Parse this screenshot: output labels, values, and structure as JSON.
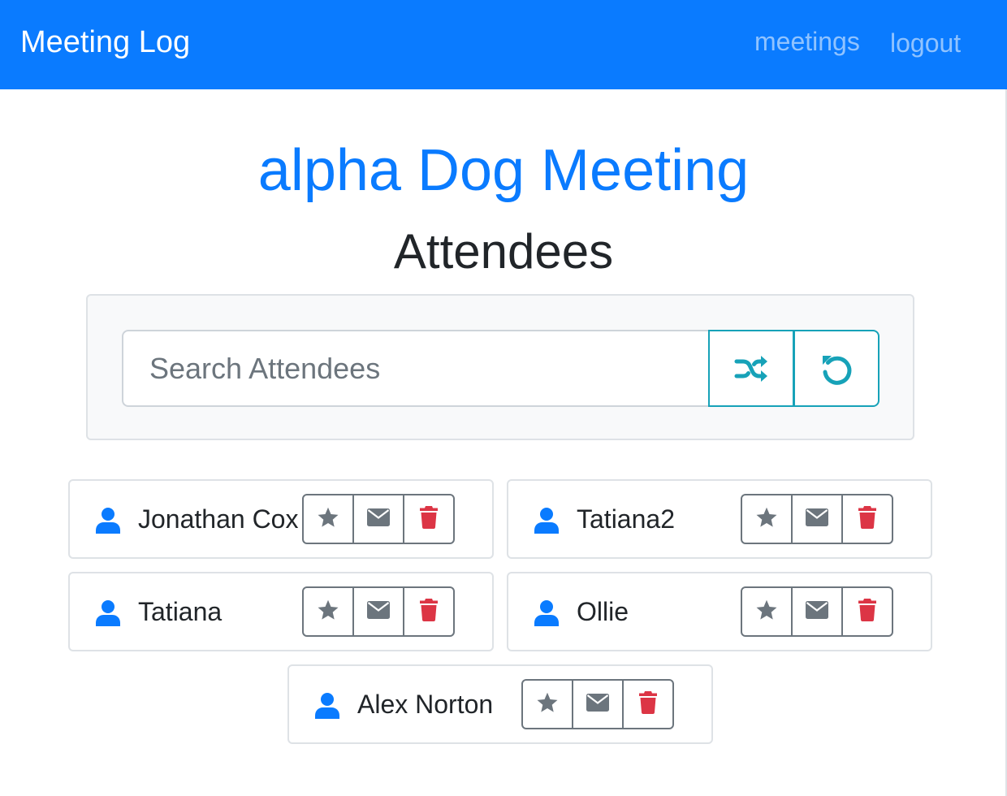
{
  "navbar": {
    "brand": "Meeting Log",
    "links": [
      "meetings",
      "logout"
    ]
  },
  "meeting": {
    "title": "alpha Dog Meeting",
    "section_heading": "Attendees"
  },
  "search": {
    "placeholder": "Search Attendees",
    "value": ""
  },
  "icons": {
    "attendee": "user-icon",
    "star": "star-icon",
    "email": "envelope-icon",
    "delete": "trash-icon",
    "shuffle": "random-icon",
    "reset": "undo-icon"
  },
  "colors": {
    "primary": "#0a7bff",
    "info": "#17a2b8",
    "secondary": "#6c757d",
    "danger": "#dc3545"
  },
  "attendees": [
    {
      "name": "Jonathan Cox"
    },
    {
      "name": "Tatiana2"
    },
    {
      "name": "Tatiana"
    },
    {
      "name": "Ollie"
    },
    {
      "name": "Alex Norton"
    }
  ]
}
